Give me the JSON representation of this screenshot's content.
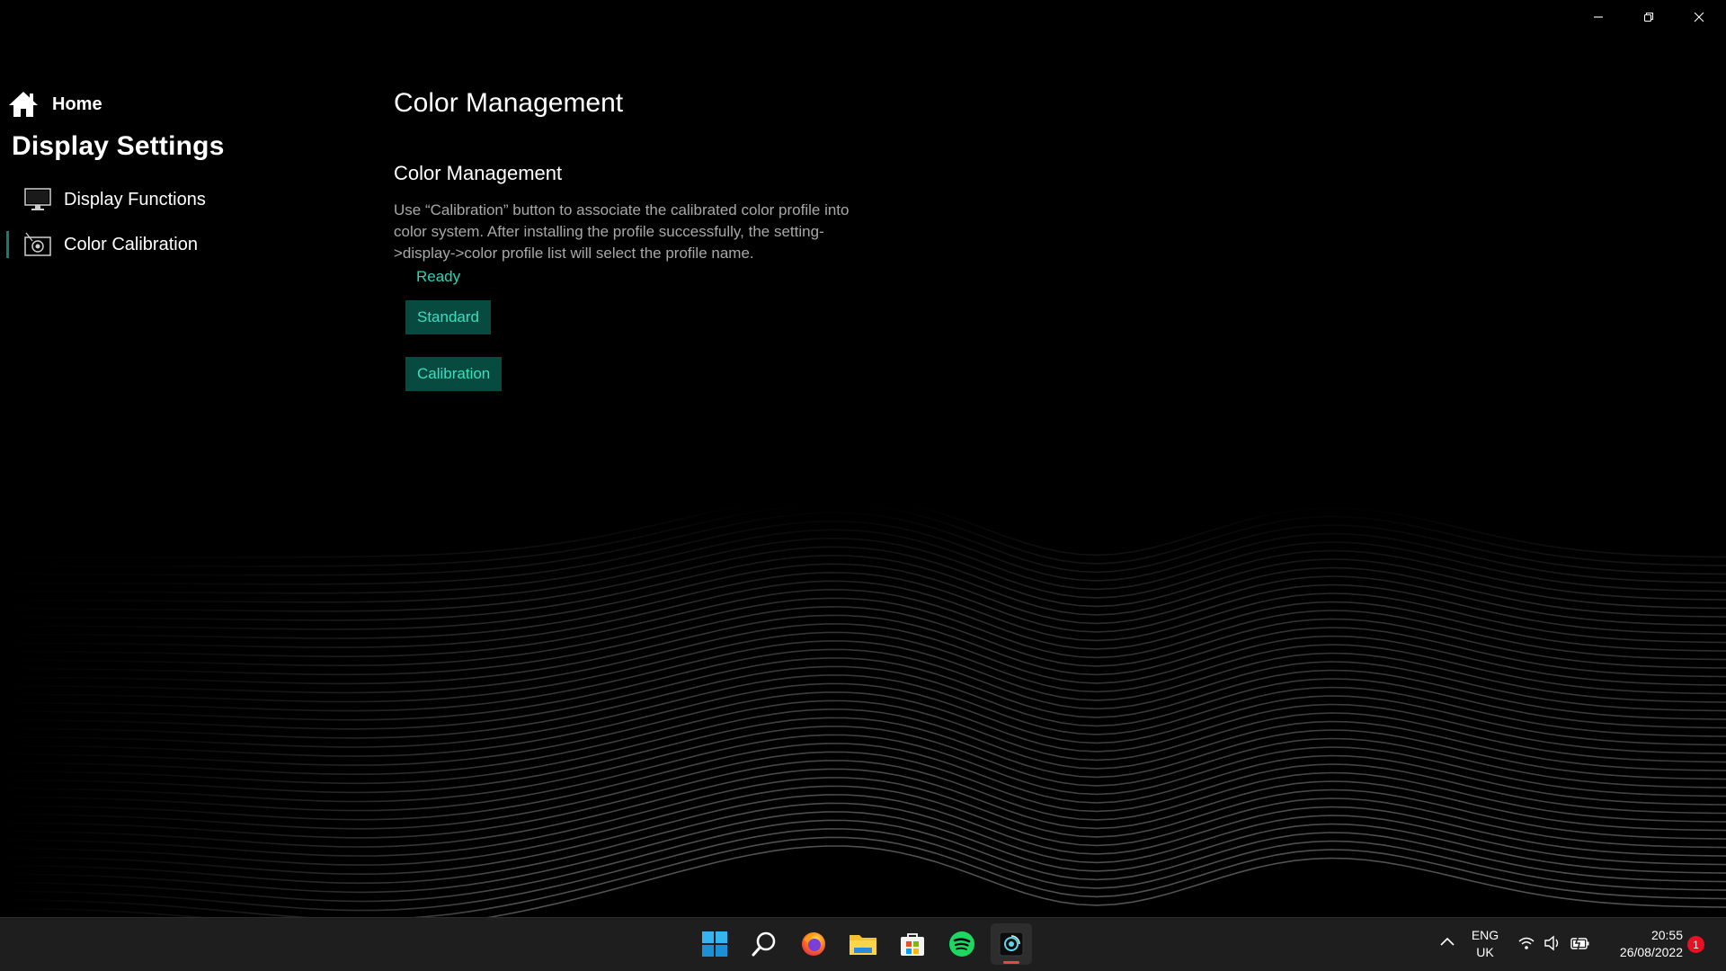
{
  "window": {
    "minimize_icon": "minimize-icon",
    "restore_icon": "restore-icon",
    "close_icon": "close-icon"
  },
  "sidebar": {
    "home_label": "Home",
    "section_title": "Display Settings",
    "items": [
      {
        "label": "Display Functions",
        "icon": "monitor-icon",
        "active": false
      },
      {
        "label": "Color Calibration",
        "icon": "color-calibration-icon",
        "active": true
      }
    ]
  },
  "main": {
    "page_title": "Color Management",
    "section_title": "Color Management",
    "description": "Use “Calibration” button to associate the calibrated color profile into color system. After installing the profile successfully, the setting->display->color profile list will select the profile name.",
    "status": "Ready",
    "standard_button": "Standard",
    "calibration_button": "Calibration"
  },
  "taskbar": {
    "apps": [
      "windows-start-icon",
      "search-icon",
      "firefox-icon",
      "file-explorer-icon",
      "microsoft-store-icon",
      "spotify-icon",
      "display-settings-app-icon"
    ],
    "language_line1": "ENG",
    "language_line2": "UK",
    "time": "20:55",
    "date": "26/08/2022",
    "notification_count": "1"
  },
  "colors": {
    "accent": "#064a40",
    "accent_text": "#37e0c1",
    "status_text": "#2ed3b7",
    "notification_badge": "#e81123"
  }
}
